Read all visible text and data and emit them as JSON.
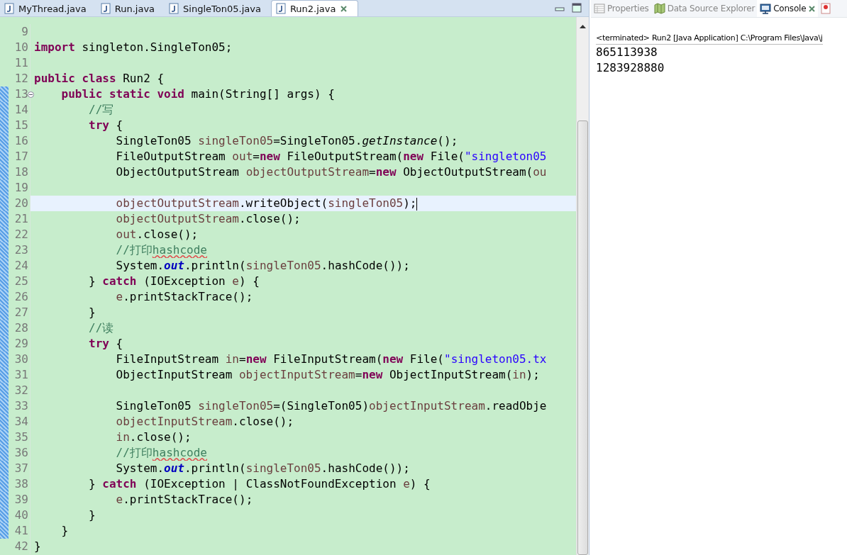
{
  "editor": {
    "tabs": [
      {
        "label": "MyThread.java",
        "selected": false
      },
      {
        "label": "Run.java",
        "selected": false
      },
      {
        "label": "SingleTon05.java",
        "selected": false
      },
      {
        "label": "Run2.java",
        "selected": true
      }
    ],
    "lines": [
      {
        "number": "9",
        "changed": false
      },
      {
        "number": "10",
        "changed": false,
        "tokens": [
          {
            "kind": "kw",
            "text": "import"
          },
          {
            "kind": "plain",
            "text": " singleton.SingleTon05;"
          }
        ]
      },
      {
        "number": "11",
        "changed": false
      },
      {
        "number": "12",
        "changed": false,
        "tokens": [
          {
            "kind": "kw",
            "text": "public class"
          },
          {
            "kind": "plain",
            "text": " Run2 {"
          }
        ]
      },
      {
        "number": "13",
        "changed": true,
        "fold": true,
        "tokens": [
          {
            "kind": "kw",
            "text": "    public static void"
          },
          {
            "kind": "plain",
            "text": " main(String[] args) {"
          }
        ]
      },
      {
        "number": "14",
        "changed": true,
        "tokens": [
          {
            "kind": "comment",
            "text": "        //写"
          }
        ]
      },
      {
        "number": "15",
        "changed": true,
        "tokens": [
          {
            "kind": "kw",
            "text": "        try"
          },
          {
            "kind": "plain",
            "text": " {"
          }
        ]
      },
      {
        "number": "16",
        "changed": true,
        "tokens": [
          {
            "kind": "plain",
            "text": "            SingleTon05 "
          },
          {
            "kind": "var",
            "text": "singleTon05"
          },
          {
            "kind": "plain",
            "text": "=SingleTon05."
          },
          {
            "kind": "italic",
            "text": "getInstance"
          },
          {
            "kind": "plain",
            "text": "();"
          }
        ]
      },
      {
        "number": "17",
        "changed": true,
        "tokens": [
          {
            "kind": "plain",
            "text": "            FileOutputStream "
          },
          {
            "kind": "var",
            "text": "out"
          },
          {
            "kind": "plain",
            "text": "="
          },
          {
            "kind": "kw",
            "text": "new"
          },
          {
            "kind": "plain",
            "text": " FileOutputStream("
          },
          {
            "kind": "kw",
            "text": "new"
          },
          {
            "kind": "plain",
            "text": " File("
          },
          {
            "kind": "string",
            "text": "\"singleton05"
          }
        ]
      },
      {
        "number": "18",
        "changed": true,
        "tokens": [
          {
            "kind": "plain",
            "text": "            ObjectOutputStream "
          },
          {
            "kind": "var",
            "text": "objectOutputStream"
          },
          {
            "kind": "plain",
            "text": "="
          },
          {
            "kind": "kw",
            "text": "new"
          },
          {
            "kind": "plain",
            "text": " ObjectOutputStream("
          },
          {
            "kind": "var",
            "text": "ou"
          }
        ]
      },
      {
        "number": "19",
        "changed": true
      },
      {
        "number": "20",
        "changed": true,
        "current": true,
        "tokens": [
          {
            "kind": "var",
            "text": "            objectOutputStream"
          },
          {
            "kind": "plain",
            "text": ".writeObject("
          },
          {
            "kind": "var",
            "text": "singleTon05"
          },
          {
            "kind": "plain",
            "text": ");"
          }
        ]
      },
      {
        "number": "21",
        "changed": true,
        "tokens": [
          {
            "kind": "var",
            "text": "            objectOutputStream"
          },
          {
            "kind": "plain",
            "text": ".close();"
          }
        ]
      },
      {
        "number": "22",
        "changed": true,
        "tokens": [
          {
            "kind": "var",
            "text": "            out"
          },
          {
            "kind": "plain",
            "text": ".close();"
          }
        ]
      },
      {
        "number": "23",
        "changed": true,
        "tokens": [
          {
            "kind": "comment",
            "text": "            //打印"
          },
          {
            "kind": "spell",
            "text": "hashcode"
          }
        ]
      },
      {
        "number": "24",
        "changed": true,
        "tokens": [
          {
            "kind": "plain",
            "text": "            System."
          },
          {
            "kind": "static",
            "text": "out"
          },
          {
            "kind": "plain",
            "text": ".println("
          },
          {
            "kind": "var",
            "text": "singleTon05"
          },
          {
            "kind": "plain",
            "text": ".hashCode());"
          }
        ]
      },
      {
        "number": "25",
        "changed": true,
        "tokens": [
          {
            "kind": "plain",
            "text": "        } "
          },
          {
            "kind": "kw",
            "text": "catch"
          },
          {
            "kind": "plain",
            "text": " (IOException "
          },
          {
            "kind": "var",
            "text": "e"
          },
          {
            "kind": "plain",
            "text": ") {"
          }
        ]
      },
      {
        "number": "26",
        "changed": true,
        "tokens": [
          {
            "kind": "var",
            "text": "            e"
          },
          {
            "kind": "plain",
            "text": ".printStackTrace();"
          }
        ]
      },
      {
        "number": "27",
        "changed": true,
        "tokens": [
          {
            "kind": "plain",
            "text": "        }"
          }
        ]
      },
      {
        "number": "28",
        "changed": true,
        "tokens": [
          {
            "kind": "comment",
            "text": "        //读"
          }
        ]
      },
      {
        "number": "29",
        "changed": true,
        "tokens": [
          {
            "kind": "kw",
            "text": "        try"
          },
          {
            "kind": "plain",
            "text": " {"
          }
        ]
      },
      {
        "number": "30",
        "changed": true,
        "tokens": [
          {
            "kind": "plain",
            "text": "            FileInputStream "
          },
          {
            "kind": "var",
            "text": "in"
          },
          {
            "kind": "plain",
            "text": "="
          },
          {
            "kind": "kw",
            "text": "new"
          },
          {
            "kind": "plain",
            "text": " FileInputStream("
          },
          {
            "kind": "kw",
            "text": "new"
          },
          {
            "kind": "plain",
            "text": " File("
          },
          {
            "kind": "string",
            "text": "\"singleton05.tx"
          }
        ]
      },
      {
        "number": "31",
        "changed": true,
        "tokens": [
          {
            "kind": "plain",
            "text": "            ObjectInputStream "
          },
          {
            "kind": "var",
            "text": "objectInputStream"
          },
          {
            "kind": "plain",
            "text": "="
          },
          {
            "kind": "kw",
            "text": "new"
          },
          {
            "kind": "plain",
            "text": " ObjectInputStream("
          },
          {
            "kind": "var",
            "text": "in"
          },
          {
            "kind": "plain",
            "text": ");"
          }
        ]
      },
      {
        "number": "32",
        "changed": true
      },
      {
        "number": "33",
        "changed": true,
        "tokens": [
          {
            "kind": "plain",
            "text": "            SingleTon05 "
          },
          {
            "kind": "var",
            "text": "singleTon05"
          },
          {
            "kind": "plain",
            "text": "=(SingleTon05)"
          },
          {
            "kind": "var",
            "text": "objectInputStream"
          },
          {
            "kind": "plain",
            "text": ".readObje"
          }
        ]
      },
      {
        "number": "34",
        "changed": true,
        "tokens": [
          {
            "kind": "var",
            "text": "            objectInputStream"
          },
          {
            "kind": "plain",
            "text": ".close();"
          }
        ]
      },
      {
        "number": "35",
        "changed": true,
        "tokens": [
          {
            "kind": "var",
            "text": "            in"
          },
          {
            "kind": "plain",
            "text": ".close();"
          }
        ]
      },
      {
        "number": "36",
        "changed": true,
        "tokens": [
          {
            "kind": "comment",
            "text": "            //打印"
          },
          {
            "kind": "spell",
            "text": "hashcode"
          }
        ]
      },
      {
        "number": "37",
        "changed": true,
        "tokens": [
          {
            "kind": "plain",
            "text": "            System."
          },
          {
            "kind": "static",
            "text": "out"
          },
          {
            "kind": "plain",
            "text": ".println("
          },
          {
            "kind": "var",
            "text": "singleTon05"
          },
          {
            "kind": "plain",
            "text": ".hashCode());"
          }
        ]
      },
      {
        "number": "38",
        "changed": true,
        "tokens": [
          {
            "kind": "plain",
            "text": "        } "
          },
          {
            "kind": "kw",
            "text": "catch"
          },
          {
            "kind": "plain",
            "text": " (IOException | ClassNotFoundException "
          },
          {
            "kind": "var",
            "text": "e"
          },
          {
            "kind": "plain",
            "text": ") {"
          }
        ]
      },
      {
        "number": "39",
        "changed": true,
        "tokens": [
          {
            "kind": "var",
            "text": "            e"
          },
          {
            "kind": "plain",
            "text": ".printStackTrace();"
          }
        ]
      },
      {
        "number": "40",
        "changed": true,
        "tokens": [
          {
            "kind": "plain",
            "text": "        }"
          }
        ]
      },
      {
        "number": "41",
        "changed": true,
        "tokens": [
          {
            "kind": "plain",
            "text": "    }"
          }
        ]
      },
      {
        "number": "42",
        "changed": false,
        "tokens": [
          {
            "kind": "plain",
            "text": "}"
          }
        ]
      }
    ]
  },
  "views": {
    "tabs": [
      {
        "label": "Properties",
        "selected": false
      },
      {
        "label": "Data Source Explorer",
        "selected": false
      },
      {
        "label": "Console",
        "selected": true
      }
    ],
    "console": {
      "header": "<terminated> Run2 [Java Application] C:\\Program Files\\Java\\j",
      "output": [
        "865113938",
        "1283928880"
      ]
    }
  }
}
